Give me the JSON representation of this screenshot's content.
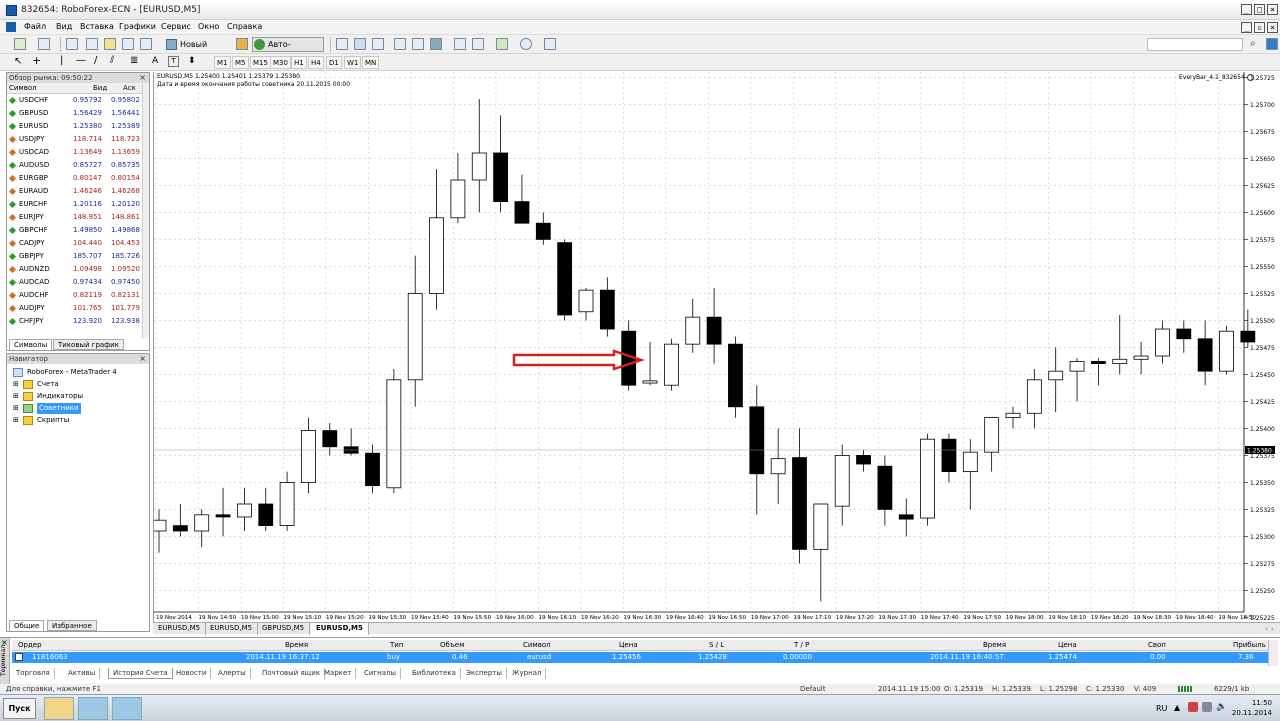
{
  "window": {
    "title": "832654: RoboForex-ECN - [EURUSD,M5]"
  },
  "menu": [
    "Файл",
    "Вид",
    "Вставка",
    "Графики",
    "Сервис",
    "Окно",
    "Справка"
  ],
  "toolbar": {
    "new_order_label": "Новый Ордер",
    "autotrade_label": "Авто-торговля",
    "timeframes": [
      "M1",
      "M5",
      "M15",
      "M30",
      "H1",
      "H4",
      "D1",
      "W1",
      "MN"
    ]
  },
  "market_watch": {
    "title": "Обзор рынка: 09:50:22",
    "col_symbol": "Символ",
    "col_bid": "Бид",
    "col_ask": "Аск",
    "rows": [
      {
        "symbol": "USDCHF",
        "bid": "0.95792",
        "ask": "0.95802",
        "dir": "up"
      },
      {
        "symbol": "GBPUSD",
        "bid": "1.56429",
        "ask": "1.56441",
        "dir": "up"
      },
      {
        "symbol": "EURUSD",
        "bid": "1.25380",
        "ask": "1.25389",
        "dir": "up"
      },
      {
        "symbol": "USDJPY",
        "bid": "118.714",
        "ask": "118.723",
        "dir": "down"
      },
      {
        "symbol": "USDCAD",
        "bid": "1.13649",
        "ask": "1.13659",
        "dir": "down"
      },
      {
        "symbol": "AUDUSD",
        "bid": "0.85727",
        "ask": "0.85735",
        "dir": "up"
      },
      {
        "symbol": "EURGBP",
        "bid": "0.80147",
        "ask": "0.80154",
        "dir": "down"
      },
      {
        "symbol": "EURAUD",
        "bid": "1.46246",
        "ask": "1.46268",
        "dir": "down"
      },
      {
        "symbol": "EURCHF",
        "bid": "1.20116",
        "ask": "1.20120",
        "dir": "up"
      },
      {
        "symbol": "EURJPY",
        "bid": "148.851",
        "ask": "148.861",
        "dir": "down"
      },
      {
        "symbol": "GBPCHF",
        "bid": "1.49850",
        "ask": "1.49868",
        "dir": "up"
      },
      {
        "symbol": "CADJPY",
        "bid": "104.440",
        "ask": "104.453",
        "dir": "down"
      },
      {
        "symbol": "GBPJPY",
        "bid": "185.707",
        "ask": "185.726",
        "dir": "up"
      },
      {
        "symbol": "AUDNZD",
        "bid": "1.09498",
        "ask": "1.09520",
        "dir": "down"
      },
      {
        "symbol": "AUDCAD",
        "bid": "0.97434",
        "ask": "0.97450",
        "dir": "up"
      },
      {
        "symbol": "AUDCHF",
        "bid": "0.82119",
        "ask": "0.82131",
        "dir": "down"
      },
      {
        "symbol": "AUDJPY",
        "bid": "101.765",
        "ask": "101.779",
        "dir": "down"
      },
      {
        "symbol": "CHFJPY",
        "bid": "123.920",
        "ask": "123.938",
        "dir": "up"
      }
    ],
    "tabs": [
      "Символы",
      "Тиковый график"
    ]
  },
  "navigator": {
    "title": "Навигатор",
    "root": "RoboForex - MetaTrader 4",
    "items": [
      "Счета",
      "Индикаторы",
      "Советники",
      "Скрипты"
    ],
    "tabs": [
      "Общие",
      "Избранное"
    ]
  },
  "chart": {
    "header_line1": "EURUSD,M5  1.25400 1.25401 1.25379 1.25380",
    "header_line2": "Дата и время окончания работы советника 20.11.2015 00:00",
    "ea_label": "EveryBar_4.1_832654",
    "current_price": "1.25380",
    "tabs": [
      "EURUSD,M5",
      "EURUSD,M5",
      "GBPUSD,M5",
      "EURUSD,M5"
    ],
    "active_tab": 3
  },
  "chart_data": {
    "type": "candlestick",
    "symbol": "EURUSD",
    "timeframe": "M5",
    "ylim": [
      1.2523,
      1.2573
    ],
    "y_ticks": [
      "1.25725",
      "1.25700",
      "1.25675",
      "1.25650",
      "1.25625",
      "1.25600",
      "1.25575",
      "1.25550",
      "1.25525",
      "1.25500",
      "1.25475",
      "1.25450",
      "1.25425",
      "1.25400",
      "1.25375",
      "1.25350",
      "1.25325",
      "1.25300",
      "1.25275",
      "1.25250",
      "1.25225"
    ],
    "x_ticks": [
      "19 Nov 2014",
      "19 Nov 14:50",
      "19 Nov 15:00",
      "19 Nov 15:10",
      "19 Nov 15:20",
      "19 Nov 15:30",
      "19 Nov 15:40",
      "19 Nov 15:50",
      "19 Nov 16:00",
      "19 Nov 16:10",
      "19 Nov 16:20",
      "19 Nov 16:30",
      "19 Nov 16:40",
      "19 Nov 16:50",
      "19 Nov 17:00",
      "19 Nov 17:10",
      "19 Nov 17:20",
      "19 Nov 17:30",
      "19 Nov 17:40",
      "19 Nov 17:50",
      "19 Nov 18:00",
      "19 Nov 18:10",
      "19 Nov 18:20",
      "19 Nov 18:30",
      "19 Nov 18:40",
      "19 Nov 18:50"
    ],
    "candles": [
      {
        "o": 1.25305,
        "h": 1.25325,
        "l": 1.25285,
        "c": 1.25315
      },
      {
        "o": 1.2531,
        "h": 1.2533,
        "l": 1.253,
        "c": 1.25305
      },
      {
        "o": 1.25305,
        "h": 1.25325,
        "l": 1.2529,
        "c": 1.2532
      },
      {
        "o": 1.2532,
        "h": 1.25345,
        "l": 1.253,
        "c": 1.25318
      },
      {
        "o": 1.25318,
        "h": 1.25345,
        "l": 1.25305,
        "c": 1.2533
      },
      {
        "o": 1.2533,
        "h": 1.25345,
        "l": 1.25305,
        "c": 1.2531
      },
      {
        "o": 1.2531,
        "h": 1.2536,
        "l": 1.25305,
        "c": 1.2535
      },
      {
        "o": 1.2535,
        "h": 1.2541,
        "l": 1.2534,
        "c": 1.25398
      },
      {
        "o": 1.25398,
        "h": 1.25405,
        "l": 1.25375,
        "c": 1.25383
      },
      {
        "o": 1.25383,
        "h": 1.254,
        "l": 1.25375,
        "c": 1.25377
      },
      {
        "o": 1.25377,
        "h": 1.25385,
        "l": 1.2534,
        "c": 1.25347
      },
      {
        "o": 1.25345,
        "h": 1.25455,
        "l": 1.2534,
        "c": 1.25445
      },
      {
        "o": 1.25445,
        "h": 1.2556,
        "l": 1.2542,
        "c": 1.25525
      },
      {
        "o": 1.25525,
        "h": 1.2564,
        "l": 1.2551,
        "c": 1.25595
      },
      {
        "o": 1.25595,
        "h": 1.25655,
        "l": 1.2559,
        "c": 1.2563
      },
      {
        "o": 1.2563,
        "h": 1.25705,
        "l": 1.256,
        "c": 1.25655
      },
      {
        "o": 1.25655,
        "h": 1.2569,
        "l": 1.256,
        "c": 1.2561
      },
      {
        "o": 1.2561,
        "h": 1.25635,
        "l": 1.2559,
        "c": 1.2559
      },
      {
        "o": 1.2559,
        "h": 1.256,
        "l": 1.2557,
        "c": 1.25575
      },
      {
        "o": 1.25572,
        "h": 1.25575,
        "l": 1.255,
        "c": 1.25505
      },
      {
        "o": 1.25508,
        "h": 1.2553,
        "l": 1.255,
        "c": 1.25528
      },
      {
        "o": 1.25528,
        "h": 1.2554,
        "l": 1.25485,
        "c": 1.25492
      },
      {
        "o": 1.2549,
        "h": 1.255,
        "l": 1.25435,
        "c": 1.2544
      },
      {
        "o": 1.25442,
        "h": 1.2548,
        "l": 1.2544,
        "c": 1.25444
      },
      {
        "o": 1.2544,
        "h": 1.25483,
        "l": 1.25435,
        "c": 1.25478
      },
      {
        "o": 1.25478,
        "h": 1.2552,
        "l": 1.2547,
        "c": 1.25503
      },
      {
        "o": 1.25503,
        "h": 1.2553,
        "l": 1.2546,
        "c": 1.25478
      },
      {
        "o": 1.25478,
        "h": 1.25485,
        "l": 1.2541,
        "c": 1.2542
      },
      {
        "o": 1.2542,
        "h": 1.2544,
        "l": 1.2532,
        "c": 1.25358
      },
      {
        "o": 1.25358,
        "h": 1.254,
        "l": 1.2533,
        "c": 1.25372
      },
      {
        "o": 1.25373,
        "h": 1.254,
        "l": 1.25275,
        "c": 1.25288
      },
      {
        "o": 1.25288,
        "h": 1.2533,
        "l": 1.2524,
        "c": 1.2533
      },
      {
        "o": 1.25328,
        "h": 1.25385,
        "l": 1.2531,
        "c": 1.25375
      },
      {
        "o": 1.25375,
        "h": 1.2538,
        "l": 1.2536,
        "c": 1.25367
      },
      {
        "o": 1.25365,
        "h": 1.25375,
        "l": 1.2531,
        "c": 1.25325
      },
      {
        "o": 1.2532,
        "h": 1.25335,
        "l": 1.253,
        "c": 1.25316
      },
      {
        "o": 1.25317,
        "h": 1.25395,
        "l": 1.2531,
        "c": 1.2539
      },
      {
        "o": 1.2539,
        "h": 1.25395,
        "l": 1.2535,
        "c": 1.2536
      },
      {
        "o": 1.2536,
        "h": 1.2539,
        "l": 1.25325,
        "c": 1.25378
      },
      {
        "o": 1.25378,
        "h": 1.2541,
        "l": 1.2536,
        "c": 1.2541
      },
      {
        "o": 1.2541,
        "h": 1.2542,
        "l": 1.254,
        "c": 1.25414
      },
      {
        "o": 1.25414,
        "h": 1.25455,
        "l": 1.254,
        "c": 1.25445
      },
      {
        "o": 1.25445,
        "h": 1.25475,
        "l": 1.25415,
        "c": 1.25453
      },
      {
        "o": 1.25453,
        "h": 1.25465,
        "l": 1.25425,
        "c": 1.25462
      },
      {
        "o": 1.25462,
        "h": 1.25465,
        "l": 1.2544,
        "c": 1.2546
      },
      {
        "o": 1.2546,
        "h": 1.25505,
        "l": 1.2545,
        "c": 1.25464
      },
      {
        "o": 1.25464,
        "h": 1.2548,
        "l": 1.2545,
        "c": 1.25467
      },
      {
        "o": 1.25467,
        "h": 1.255,
        "l": 1.2546,
        "c": 1.25492
      },
      {
        "o": 1.25492,
        "h": 1.255,
        "l": 1.2547,
        "c": 1.25483
      },
      {
        "o": 1.25483,
        "h": 1.255,
        "l": 1.2544,
        "c": 1.25453
      },
      {
        "o": 1.25453,
        "h": 1.25495,
        "l": 1.2545,
        "c": 1.2549
      },
      {
        "o": 1.2549,
        "h": 1.2551,
        "l": 1.25475,
        "c": 1.2548
      }
    ]
  },
  "terminal": {
    "side_label": "Терминал",
    "headers": {
      "order": "Ордер",
      "time": "Время",
      "type": "Тип",
      "volume": "Объем",
      "symbol": "Символ",
      "price": "Цена",
      "sl": "S / L",
      "tp": "T / P",
      "close_time": "Время",
      "close_price": "Цена",
      "swap": "Своп",
      "profit": "Прибыль"
    },
    "row": {
      "order": "11816063",
      "time": "2014.11.19 16:37:12",
      "type": "buy",
      "volume": "0.46",
      "symbol": "eurusd",
      "price": "1.25456",
      "sl": "1.25428",
      "tp": "0.00000",
      "close_time": "2014.11.19 16:40:57",
      "close_price": "1.25474",
      "swap": "0.00",
      "profit": "7.36"
    },
    "tabs": [
      "Торговля",
      "Активы",
      "История Счета",
      "Новости",
      "Алерты",
      "Почтовый ящик",
      "Маркет",
      "Сигналы",
      "Библиотека",
      "Эксперты",
      "Журнал"
    ],
    "active_tab": 2
  },
  "status": {
    "help": "Для справки, нажмите F1",
    "profile": "Default",
    "datetime": "2014.11.19 15:00",
    "open": "O: 1.25319",
    "high": "H: 1.25339",
    "low": "L: 1.25298",
    "close": "C: 1.25330",
    "volume": "V: 409",
    "traffic": "6229/1 kb"
  },
  "taskbar": {
    "start": "Пуск",
    "lang": "RU",
    "time": "11:50",
    "date": "20.11.2014"
  }
}
